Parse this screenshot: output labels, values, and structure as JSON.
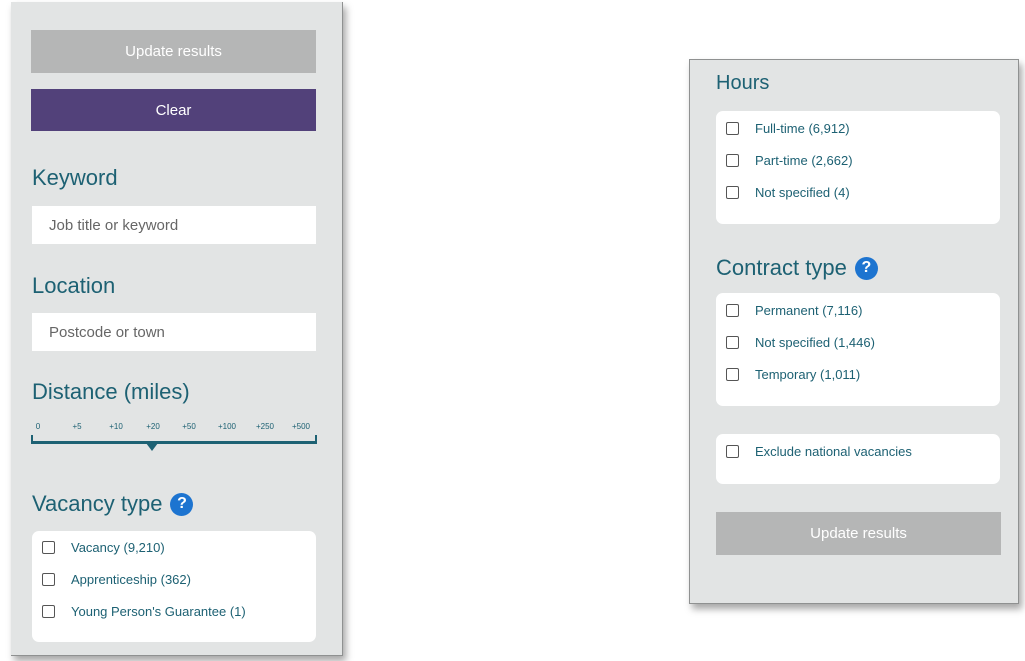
{
  "left": {
    "update_button": "Update results",
    "clear_button": "Clear",
    "keyword": {
      "heading": "Keyword",
      "placeholder": "Job title or keyword"
    },
    "location": {
      "heading": "Location",
      "placeholder": "Postcode or town"
    },
    "distance": {
      "heading": "Distance (miles)",
      "ticks": [
        "0",
        "+5",
        "+10",
        "+20",
        "+50",
        "+100",
        "+250",
        "+500"
      ],
      "selected": "+20"
    },
    "vacancy_type": {
      "heading": "Vacancy type",
      "help": "?",
      "options": [
        "Vacancy (9,210)",
        "Apprenticeship (362)",
        "Young Person's Guarantee (1)"
      ]
    }
  },
  "right": {
    "hours": {
      "heading": "Hours",
      "options": [
        "Full-time (6,912)",
        "Part-time (2,662)",
        "Not specified (4)"
      ]
    },
    "contract_type": {
      "heading": "Contract type",
      "help": "?",
      "options": [
        "Permanent (7,116)",
        "Not specified (1,446)",
        "Temporary (1,011)"
      ]
    },
    "exclude_national": "Exclude national vacancies",
    "update_button": "Update results"
  },
  "colors": {
    "heading": "#1d6173",
    "clear_button": "#52417a",
    "update_button": "#b5b6b6",
    "help_icon": "#1d74d0",
    "panel": "#e2e4e4"
  }
}
